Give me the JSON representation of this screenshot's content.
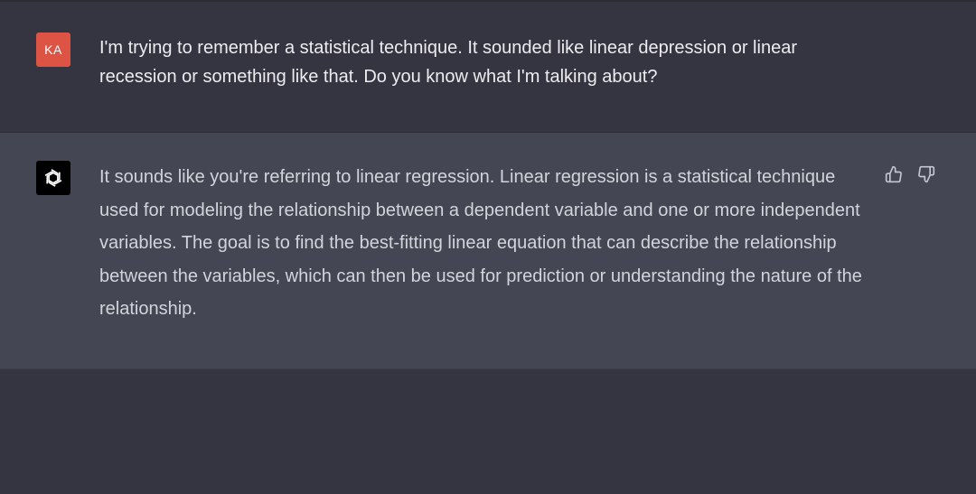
{
  "user_message": {
    "avatar_initials": "KA",
    "text": "I'm trying to remember a statistical technique. It sounded like linear depression or linear recession or something like that. Do you know what I'm talking about?"
  },
  "assistant_message": {
    "avatar_icon": "openai-logo-icon",
    "text": "It sounds like you're referring to linear regression. Linear regression is a statistical technique used for modeling the relationship between a dependent variable and one or more independent variables. The goal is to find the best-fitting linear equation that can describe the relationship between the variables, which can then be used for prediction or understanding the nature of the relationship.",
    "feedback_icons": [
      "thumbs-up-icon",
      "thumbs-down-icon"
    ]
  },
  "colors": {
    "page_background": "#343541",
    "assistant_background": "#444654",
    "user_avatar": "#de5444",
    "assistant_avatar": "#000000",
    "user_text": "#ececf1",
    "assistant_text": "#d1d5db"
  }
}
